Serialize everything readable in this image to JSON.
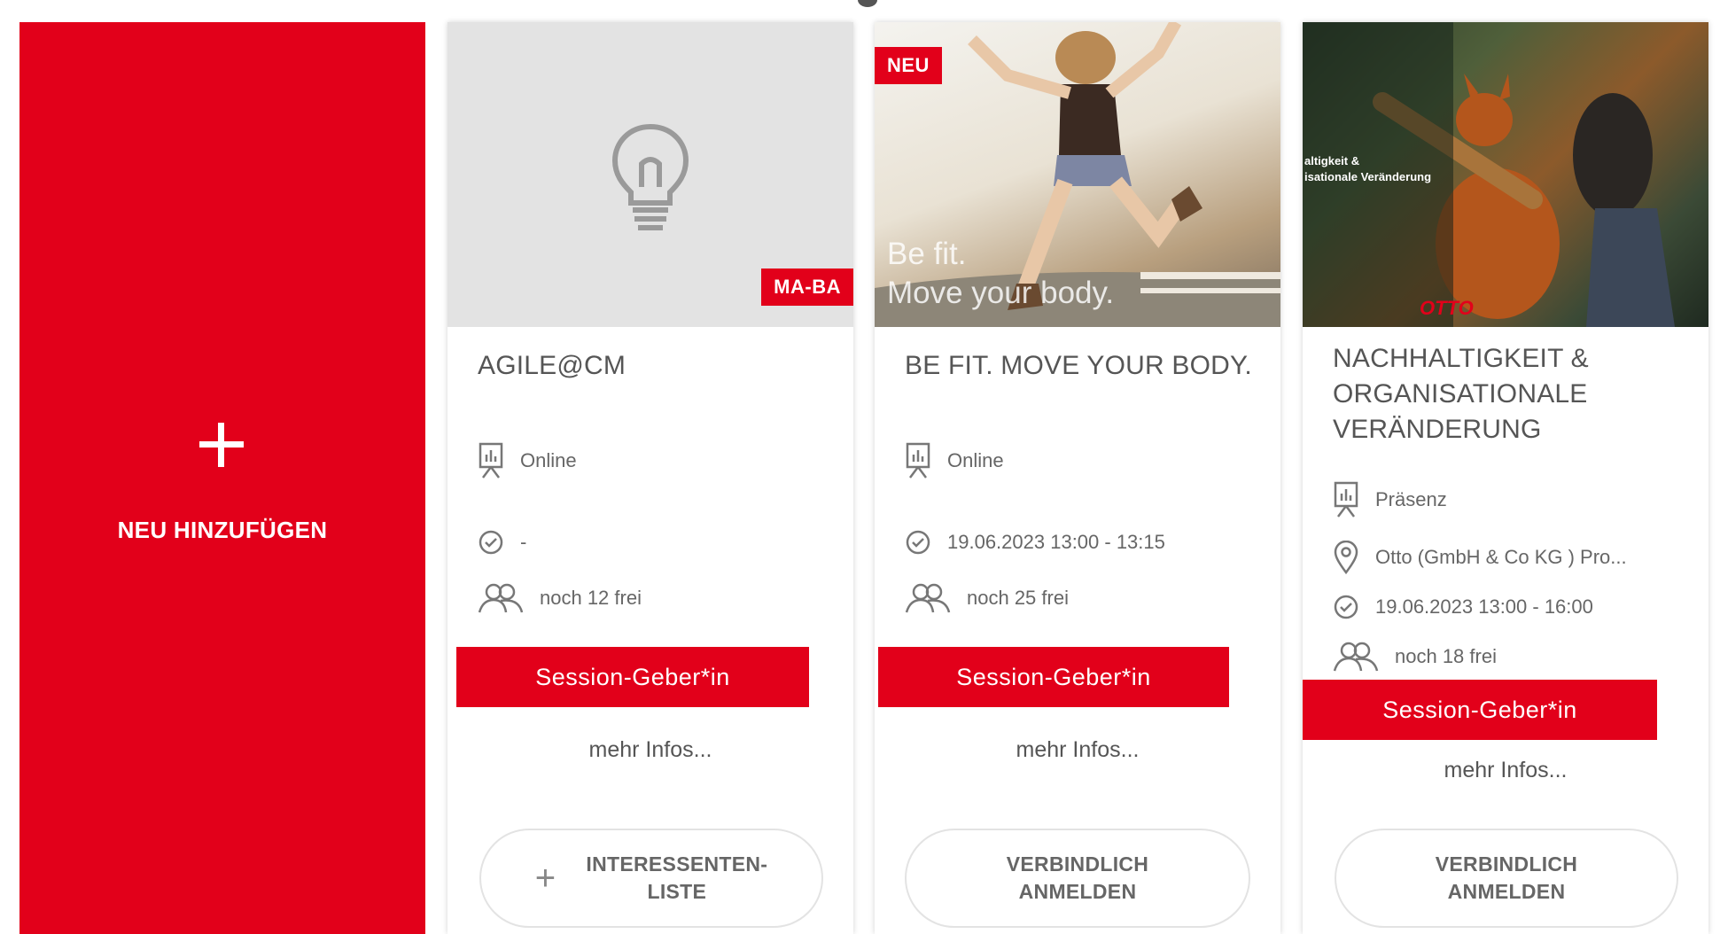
{
  "add_card": {
    "label": "NEU HINZUFÜGEN"
  },
  "cards": [
    {
      "badge": "MA-BA",
      "title": "AGILE@CM",
      "format": "Online",
      "time": "-",
      "seats": "noch 12 frei",
      "role_button": "Session-Geber*in",
      "more": "mehr Infos...",
      "action": "INTERESSENTEN-\nLISTE"
    },
    {
      "badge": "NEU",
      "image_text": [
        "Be fit.",
        "Move your body."
      ],
      "title": "BE FIT. MOVE YOUR BODY.",
      "format": "Online",
      "time": "19.06.2023 13:00 - 13:15",
      "seats": "noch 25 frei",
      "role_button": "Session-Geber*in",
      "more": "mehr Infos...",
      "action": "VERBINDLICH\nANMELDEN"
    },
    {
      "image_text": [
        "altigkeit &",
        "isationale Veränderung"
      ],
      "image_logo": "OTTO",
      "title": "NACHHALTIGKEIT & ORGANISATIONALE VERÄNDERUNG",
      "format": "Präsenz",
      "location": "Otto (GmbH & Co KG ) Pro...",
      "time": "19.06.2023 13:00 - 16:00",
      "seats": "noch 18 frei",
      "role_button": "Session-Geber*in",
      "more": "mehr Infos...",
      "action": "VERBINDLICH\nANMELDEN"
    }
  ],
  "colors": {
    "accent": "#e2001a",
    "text": "#555555",
    "muted": "#666666",
    "placeholder_bg": "#e3e3e3"
  }
}
